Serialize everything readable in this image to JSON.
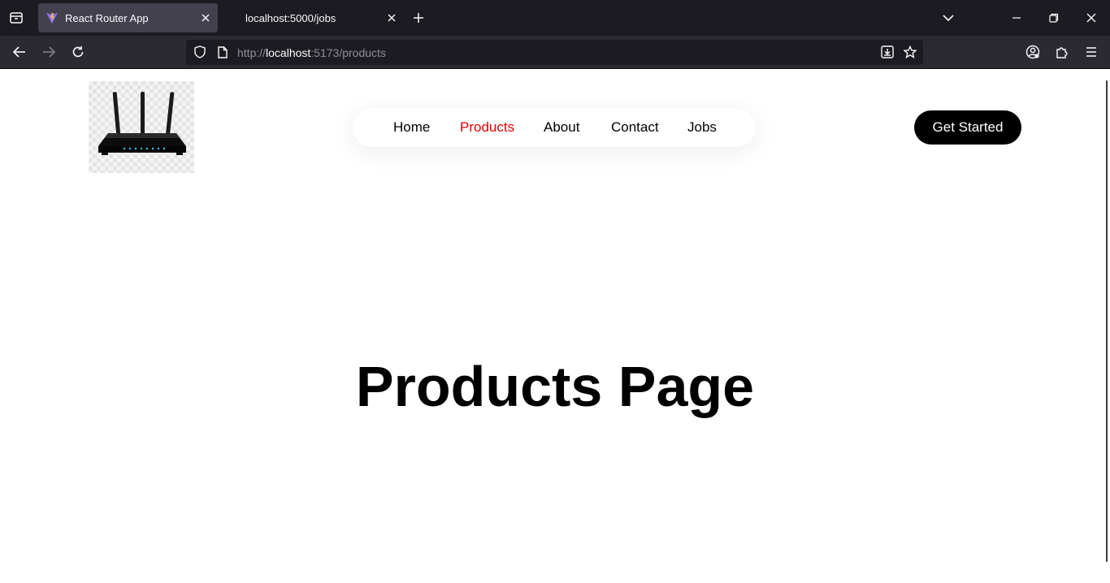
{
  "browser": {
    "tabs": [
      {
        "title": "React Router App",
        "active": true
      },
      {
        "title": "localhost:5000/jobs",
        "active": false
      }
    ],
    "url": {
      "scheme": "http://",
      "host": "localhost",
      "path": ":5173/products"
    },
    "icons": {
      "tab_overview": "tab-overview-icon",
      "new_tab": "plus-icon",
      "list_all_tabs": "chevron-down-icon",
      "minimize": "minimize-icon",
      "restore": "restore-icon",
      "close_window": "close-icon",
      "back": "back-arrow-icon",
      "forward": "forward-arrow-icon",
      "reload": "reload-icon",
      "tracking_protection": "shield-icon",
      "page_info": "page-icon",
      "install": "install-icon",
      "bookmark": "star-icon",
      "account": "account-icon",
      "extensions": "puzzle-icon",
      "menu": "hamburger-icon"
    },
    "colors": {
      "tabbar": "#1c1b22",
      "toolbar": "#2b2a33",
      "active_tab": "#42414d"
    }
  },
  "site": {
    "logo": "router-image",
    "nav": {
      "items": [
        {
          "label": "Home",
          "active": false
        },
        {
          "label": "Products",
          "active": true
        },
        {
          "label": "About",
          "active": false
        },
        {
          "label": "Contact",
          "active": false
        },
        {
          "label": "Jobs",
          "active": false
        }
      ],
      "active_color": "#e00000"
    },
    "cta_label": "Get Started",
    "page_title": "Products Page"
  }
}
